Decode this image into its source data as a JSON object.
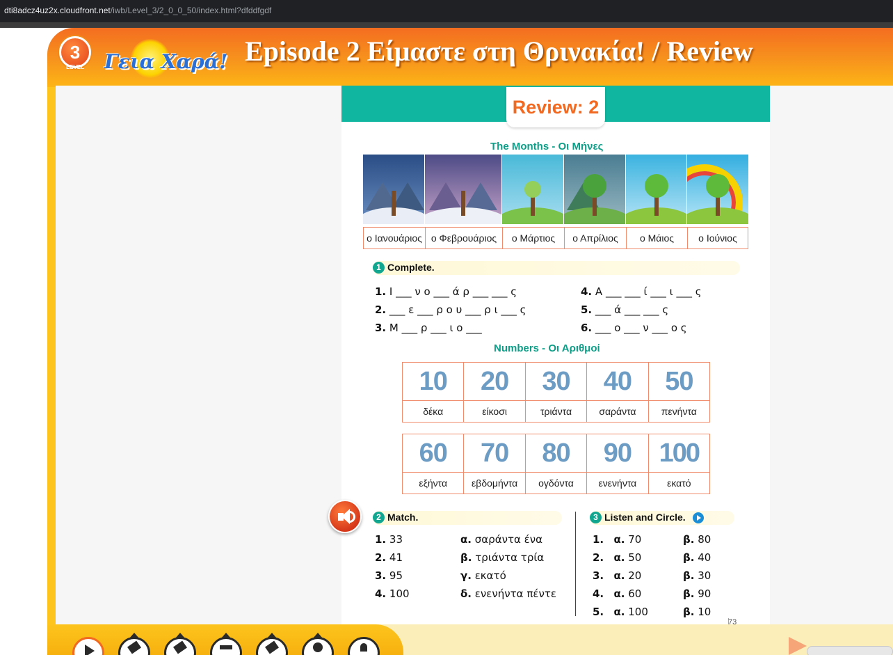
{
  "browser": {
    "url_host": "dti8adcz4uz2x.cloudfront.net",
    "url_path": "/iwb/Level_3/2_0_0_50/index.html?dfddfgdf"
  },
  "header": {
    "level_number": "3",
    "level_label": "LEVEL",
    "logo_text": "Γεια Χαρά!",
    "title": "Episode 2 Είμαστε στη Θρινακία! / Review"
  },
  "review_badge": "Review: 2",
  "months_section": {
    "title": "The Months - Οι Μήνες",
    "months": [
      {
        "label": "ο Ιανουάριος",
        "scene": "winter-snow"
      },
      {
        "label": "ο Φεβρουάριος",
        "scene": "winter-dusk"
      },
      {
        "label": "ο Μάρτιος",
        "scene": "spring-bud"
      },
      {
        "label": "ο Απρίλιος",
        "scene": "spring-rain"
      },
      {
        "label": "ο Μάιος",
        "scene": "spring-sun"
      },
      {
        "label": "ο Ιούνιος",
        "scene": "summer-rainbow"
      }
    ]
  },
  "complete": {
    "number": "1",
    "label": "Complete.",
    "items": [
      {
        "n": "1.",
        "text": "Ι ___ ν ο ___ ά ρ ___ ___ ς"
      },
      {
        "n": "2.",
        "text": "___ ε ___ ρ ο υ ___ ρ ι ___ ς"
      },
      {
        "n": "3.",
        "text": "Μ ___ ρ ___ ι ο ___"
      },
      {
        "n": "4.",
        "text": "Α ___ ___ ί ___ ι ___ ς"
      },
      {
        "n": "5.",
        "text": "___ ά ___ ___ ς"
      },
      {
        "n": "6.",
        "text": "___ ο ___ ν ___ ο ς"
      }
    ]
  },
  "numbers_section": {
    "title": "Numbers - Οι Αριθμοί",
    "row1": [
      {
        "num": "10",
        "word": "δέκα"
      },
      {
        "num": "20",
        "word": "είκοσι"
      },
      {
        "num": "30",
        "word": "τριάντα"
      },
      {
        "num": "40",
        "word": "σαράντα"
      },
      {
        "num": "50",
        "word": "πενήντα"
      }
    ],
    "row2": [
      {
        "num": "60",
        "word": "εξήντα"
      },
      {
        "num": "70",
        "word": "εβδομήντα"
      },
      {
        "num": "80",
        "word": "ογδόντα"
      },
      {
        "num": "90",
        "word": "ενενήντα"
      },
      {
        "num": "100",
        "word": "εκατό"
      }
    ]
  },
  "match": {
    "number": "2",
    "label": "Match.",
    "left": [
      {
        "n": "1.",
        "text": "33"
      },
      {
        "n": "2.",
        "text": "41"
      },
      {
        "n": "3.",
        "text": "95"
      },
      {
        "n": "4.",
        "text": "100"
      }
    ],
    "right": [
      {
        "n": "α.",
        "text": "σαράντα ένα"
      },
      {
        "n": "β.",
        "text": "τριάντα τρία"
      },
      {
        "n": "γ.",
        "text": "εκατό"
      },
      {
        "n": "δ.",
        "text": "ενενήντα πέντε"
      }
    ]
  },
  "listen": {
    "number": "3",
    "label": "Listen and Circle.",
    "items": [
      {
        "n": "1.",
        "a": "α.",
        "a_val": "70",
        "b": "β.",
        "b_val": "80"
      },
      {
        "n": "2.",
        "a": "α.",
        "a_val": "50",
        "b": "β.",
        "b_val": "40"
      },
      {
        "n": "3.",
        "a": "α.",
        "a_val": "20",
        "b": "β.",
        "b_val": "30"
      },
      {
        "n": "4.",
        "a": "α.",
        "a_val": "60",
        "b": "β.",
        "b_val": "90"
      },
      {
        "n": "5.",
        "a": "α.",
        "a_val": "100",
        "b": "β.",
        "b_val": "10"
      }
    ]
  },
  "page_number": "73",
  "colors": {
    "accent_orange": "#f26a21",
    "teal": "#10b69f",
    "number_blue": "#6c9bc4",
    "border_salmon": "#f08c6c"
  },
  "toolbar": {
    "tools": [
      "play-icon",
      "pen-icon",
      "marker-icon",
      "camera-icon",
      "eraser-icon",
      "clock-icon",
      "help-icon"
    ]
  }
}
